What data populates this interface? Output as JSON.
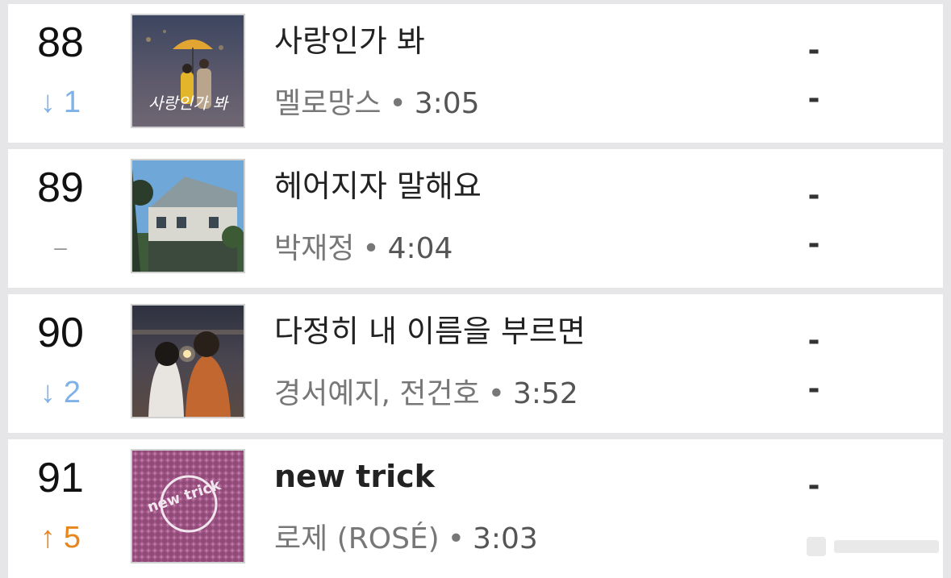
{
  "entries": [
    {
      "rank": "88",
      "change_arrow": "↓",
      "change_value": "1",
      "change_type": "down",
      "title": "사랑인가 봐",
      "artist": "멜로망스",
      "separator": "•",
      "duration": "3:05",
      "stat_top": "-",
      "stat_bottom": "-"
    },
    {
      "rank": "89",
      "change_arrow": "",
      "change_value": "–",
      "change_type": "same",
      "title": "헤어지자 말해요",
      "artist": "박재정",
      "separator": "•",
      "duration": "4:04",
      "stat_top": "-",
      "stat_bottom": "-"
    },
    {
      "rank": "90",
      "change_arrow": "↓",
      "change_value": "2",
      "change_type": "down",
      "title": "다정히 내 이름을 부르면",
      "artist": "경서예지, 전건호",
      "separator": "•",
      "duration": "3:52",
      "stat_top": "-",
      "stat_bottom": "-"
    },
    {
      "rank": "91",
      "change_arrow": "↑",
      "change_value": "5",
      "change_type": "up",
      "title": "new trick",
      "artist": "로제 (ROSÉ)",
      "separator": "•",
      "duration": "3:03",
      "stat_top": "-",
      "stat_bottom": ""
    }
  ],
  "covers": {
    "88": {
      "icon": "album-cover-couple-umbrella",
      "script_text": "사랑인가 봐"
    },
    "89": {
      "icon": "album-cover-house"
    },
    "90": {
      "icon": "album-cover-couple-sparkler"
    },
    "91": {
      "icon": "album-cover-new-trick",
      "logo_text": "new trick"
    }
  },
  "colors": {
    "down": "#7fb2e6",
    "up": "#e6861d",
    "same": "#999999"
  }
}
